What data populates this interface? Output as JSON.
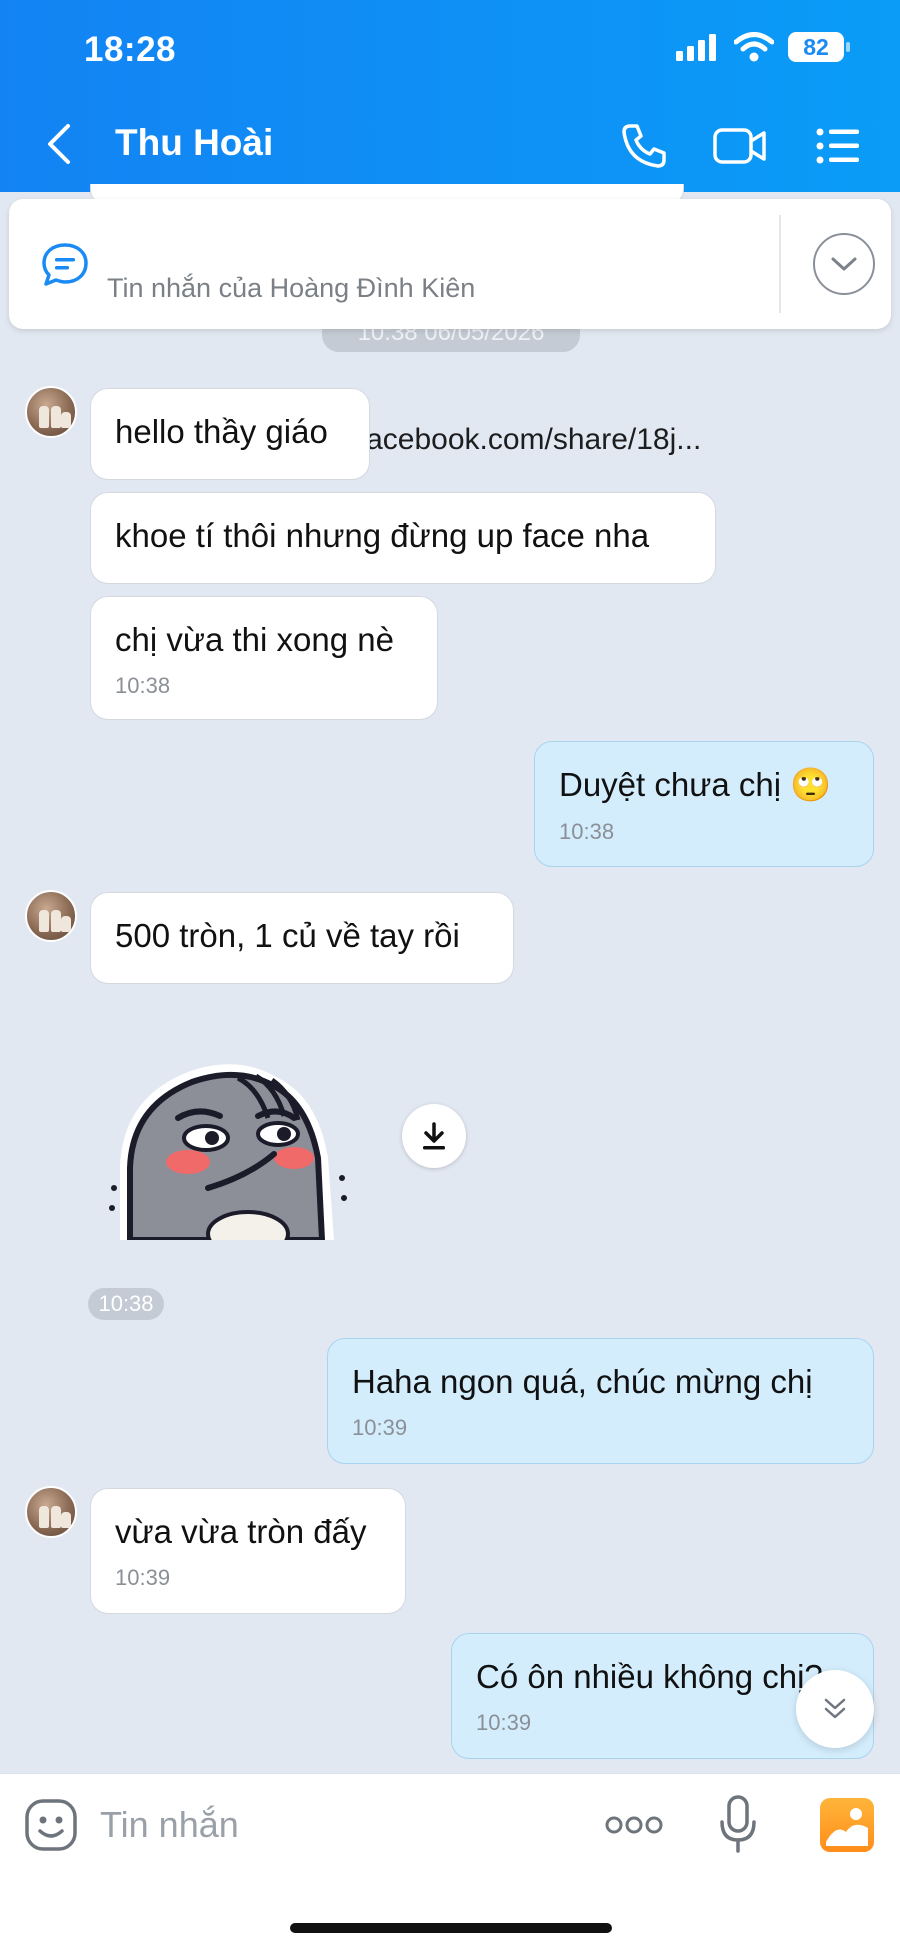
{
  "status_bar": {
    "time": "18:28",
    "battery": "82"
  },
  "header": {
    "contact_name": "Thu Hoài"
  },
  "pinned": {
    "title": "[Link] https://www.facebook.com/share/18j...",
    "subtitle": "Tin nhắn của Hoàng Đình Kiên"
  },
  "date_divider": "10:38 06/05/2026",
  "messages": [
    {
      "dir": "in",
      "text": "hello thầy giáo"
    },
    {
      "dir": "in",
      "text": "khoe tí thôi nhưng đừng up face nha"
    },
    {
      "dir": "in",
      "text": "chị vừa thi xong nè",
      "time": "10:38"
    },
    {
      "dir": "out",
      "text": "Duyệt chưa chị 🙄",
      "time": "10:38"
    },
    {
      "dir": "in",
      "text": "500 tròn, 1 củ về tay rồi"
    },
    {
      "dir": "in",
      "type": "sticker",
      "time": "10:38"
    },
    {
      "dir": "out",
      "text": "Haha ngon quá, chúc mừng chị",
      "time": "10:39"
    },
    {
      "dir": "in",
      "text": "vừa vừa tròn đấy",
      "time": "10:39"
    },
    {
      "dir": "out",
      "text": "Có ôn nhiều không chị?",
      "time": "10:39"
    }
  ],
  "composer": {
    "placeholder": "Tin nhắn"
  },
  "icons": {
    "back": "chevron-left-icon",
    "call": "phone-icon",
    "video": "video-camera-icon",
    "menu": "list-menu-icon",
    "pinned": "chat-bubble-icon",
    "expand": "chevron-down-icon",
    "download": "download-icon",
    "scroll": "double-chevron-down-icon",
    "emoji": "emoji-icon",
    "more": "more-dots-icon",
    "mic": "microphone-icon",
    "image": "image-icon"
  },
  "colors": {
    "header": "#0e8ff5",
    "outgoing_bubble": "#d3edfd",
    "background": "#e2e8f1"
  }
}
